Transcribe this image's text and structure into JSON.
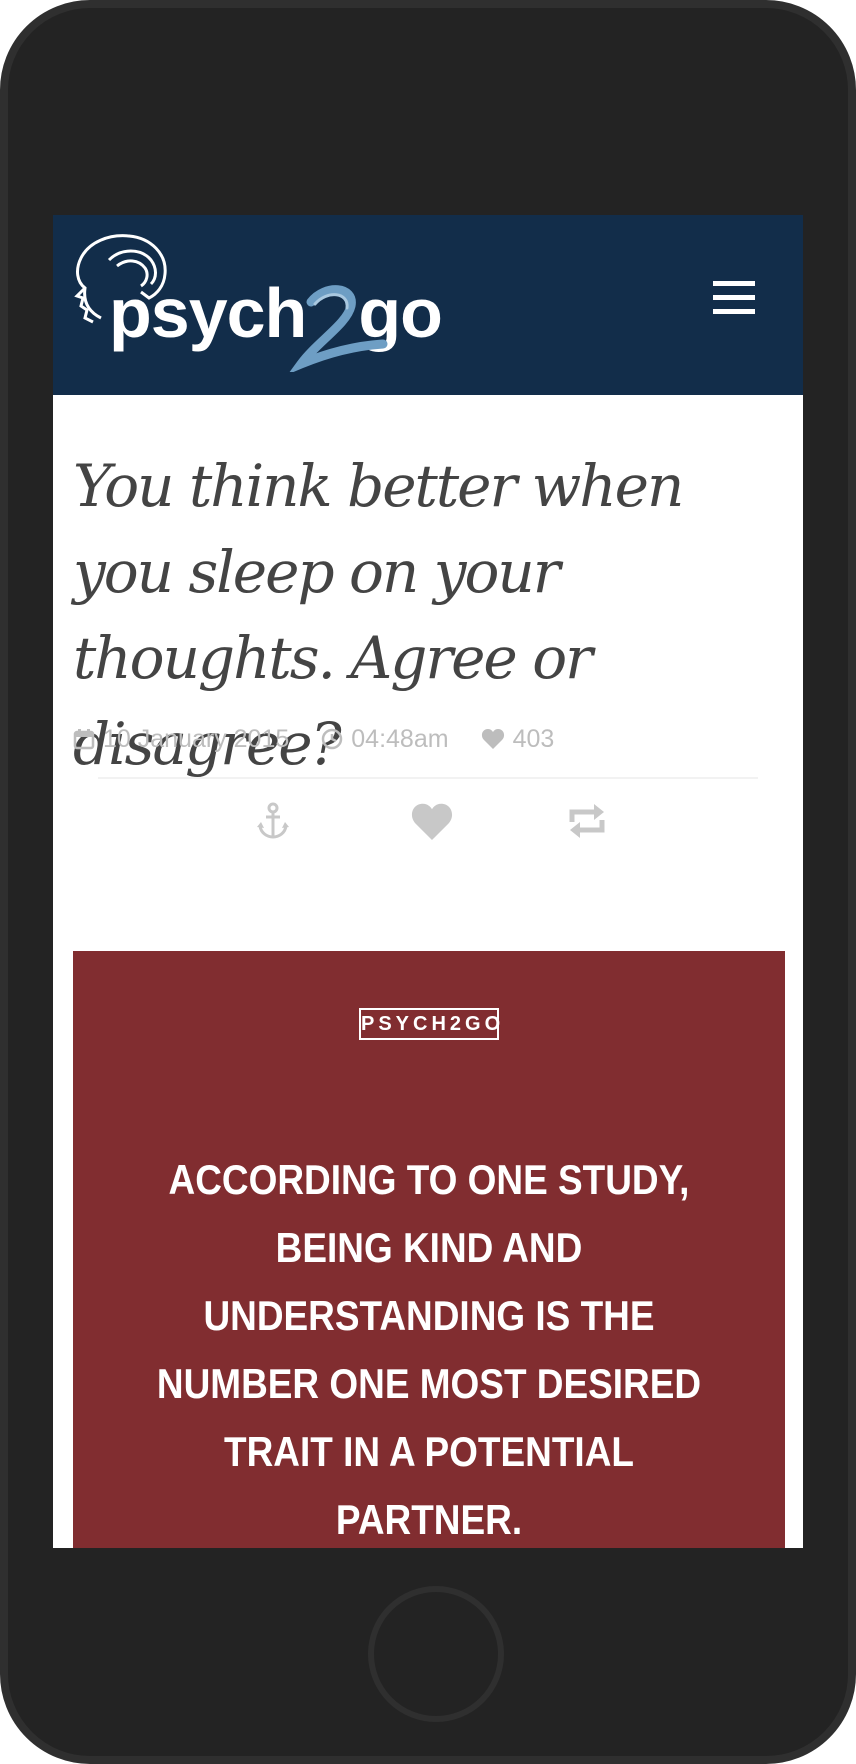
{
  "header": {
    "logo_text_left": "psych",
    "logo_text_right": "go",
    "logo_alt": "psych2go",
    "menu_icon": "hamburger-menu-icon",
    "background": "#122d4a"
  },
  "article": {
    "title": "You think better when you sleep on your thoughts. Agree or disagree?",
    "date": "10 January 2015",
    "time": "04:48am",
    "likes": "403"
  },
  "actions": {
    "pin_icon": "anchor-icon",
    "like_icon": "heart-icon",
    "reblog_icon": "reblog-icon"
  },
  "image_card": {
    "badge": "PSYCH2GO",
    "quote": "According to one study, being kind and understanding is the number one most desired trait in a potential partner.",
    "background": "#812d30"
  }
}
